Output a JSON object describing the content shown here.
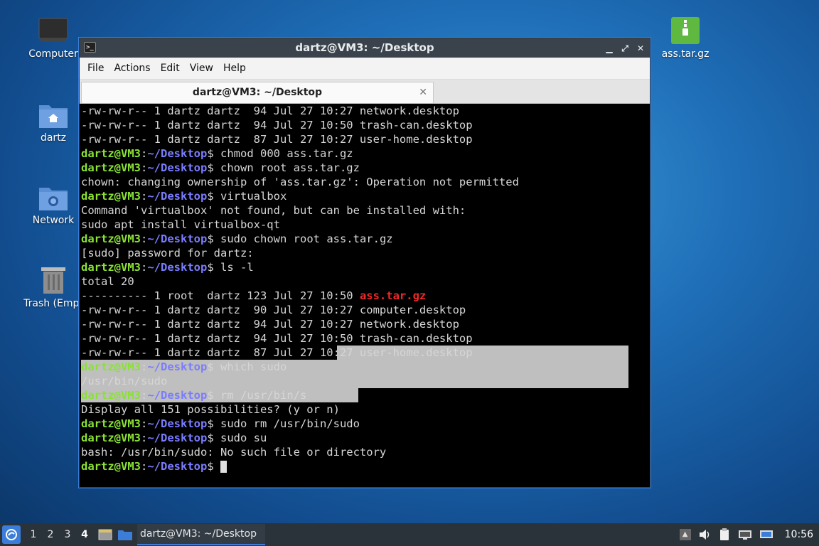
{
  "desktop": {
    "icons": [
      {
        "label": "Computer"
      },
      {
        "label": "dartz"
      },
      {
        "label": "Network"
      },
      {
        "label": "Trash (Empt"
      },
      {
        "label": "ass.tar.gz"
      }
    ]
  },
  "window": {
    "title": "dartz@VM3: ~/Desktop",
    "menu": [
      "File",
      "Actions",
      "Edit",
      "View",
      "Help"
    ],
    "tab_label": "dartz@VM3: ~/Desktop"
  },
  "terminal": {
    "user": "dartz@VM3",
    "path": "~/Desktop",
    "lines": {
      "l1": "-rw-rw-r-- 1 dartz dartz  94 Jul 27 10:27 network.desktop",
      "l2": "-rw-rw-r-- 1 dartz dartz  94 Jul 27 10:50 trash-can.desktop",
      "l3": "-rw-rw-r-- 1 dartz dartz  87 Jul 27 10:27 user-home.desktop",
      "c4": "$ chmod 000 ass.tar.gz",
      "c5": "$ chown root ass.tar.gz",
      "l6": "chown: changing ownership of 'ass.tar.gz': Operation not permitted",
      "c7": "$ virtualbox",
      "l8": "Command 'virtualbox' not found, but can be installed with:",
      "l9": "sudo apt install virtualbox-qt",
      "c10": "$ sudo chown root ass.tar.gz",
      "l11": "[sudo] password for dartz:",
      "c12": "$ ls -l",
      "l13": "total 20",
      "l14a": "---------- 1 root  dartz 123 Jul 27 10:50 ",
      "l14b": "ass.tar.gz",
      "l15": "-rw-rw-r-- 1 dartz dartz  90 Jul 27 10:27 computer.desktop",
      "l16": "-rw-rw-r-- 1 dartz dartz  94 Jul 27 10:27 network.desktop",
      "l17": "-rw-rw-r-- 1 dartz dartz  94 Jul 27 10:50 trash-can.desktop",
      "l18": "-rw-rw-r-- 1 dartz dartz  87 Jul 27 10:27 user-home.desktop",
      "c19": "$ which sudo",
      "l20": "/usr/bin/sudo",
      "c21": "$ rm /usr/bin/s",
      "l22": "Display all 151 possibilities? (y or n)",
      "c23": "$ sudo rm /usr/bin/sudo",
      "c24": "$ sudo su",
      "l25": "bash: /usr/bin/sudo: No such file or directory",
      "c26": "$ "
    }
  },
  "taskbar": {
    "workspaces": [
      "1",
      "2",
      "3",
      "4"
    ],
    "active_workspace": "4",
    "task_label": "dartz@VM3: ~/Desktop",
    "clock": "10:56"
  },
  "colors": {
    "prompt_user": "#8ae234",
    "prompt_path": "#7a7cff",
    "archive_file": "#ef2929",
    "selection": "#bfbfbf"
  }
}
